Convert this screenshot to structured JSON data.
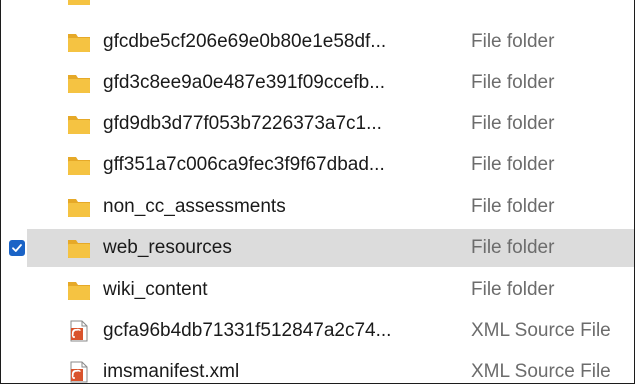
{
  "files": [
    {
      "name": "gfcdbe5cf206e69e0b80e1e58df...",
      "type": "File folder",
      "icon": "folder-icon"
    },
    {
      "name": "gfd3c8ee9a0e487e391f09ccefb...",
      "type": "File folder",
      "icon": "folder-icon"
    },
    {
      "name": "gfd9db3d77f053b7226373a7c1...",
      "type": "File folder",
      "icon": "folder-icon"
    },
    {
      "name": "gff351a7c006ca9fec3f9f67dbad...",
      "type": "File folder",
      "icon": "folder-icon"
    },
    {
      "name": "non_cc_assessments",
      "type": "File folder",
      "icon": "folder-icon"
    },
    {
      "name": "web_resources",
      "type": "File folder",
      "icon": "folder-icon",
      "selected": true
    },
    {
      "name": "wiki_content",
      "type": "File folder",
      "icon": "folder-icon"
    },
    {
      "name": "gcfa96b4db71331f512847a2c74...",
      "type": "XML Source File",
      "icon": "xml-file-icon"
    },
    {
      "name": "imsmanifest.xml",
      "type": "XML Source File",
      "icon": "xml-file-icon"
    }
  ],
  "colors": {
    "folder": "#f5c342",
    "folder_back": "#e6a928",
    "selection": "#dcdcdc",
    "checkbox": "#1a63c6",
    "xml": "#d9532c"
  }
}
